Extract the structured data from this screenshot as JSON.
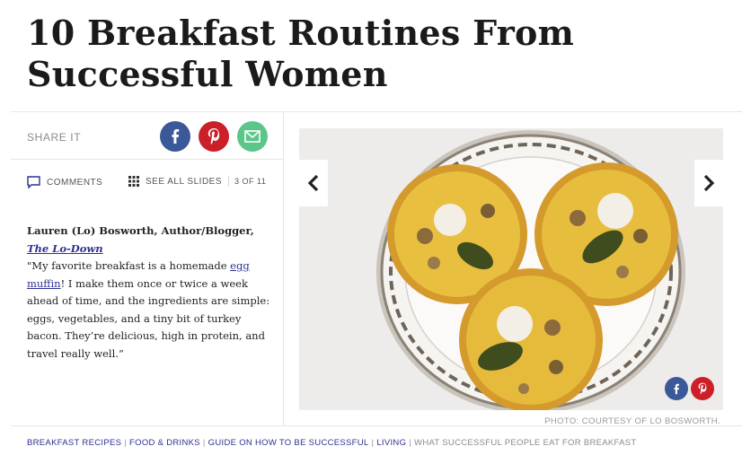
{
  "article": {
    "title": "10 Breakfast Routines From Successful Women"
  },
  "share": {
    "label": "SHARE IT",
    "icons": [
      "facebook-icon",
      "pinterest-icon",
      "email-icon"
    ],
    "colors": {
      "facebook": "#3b5998",
      "pinterest": "#cb2027",
      "email": "#5cc68a"
    }
  },
  "toolbar": {
    "comments_label": "COMMENTS",
    "slides_label": "SEE ALL SLIDES",
    "slide_count": "3 OF 11"
  },
  "slide": {
    "person": "Lauren (Lo) Bosworth, Author/Blogger,",
    "blog_link": "The Lo-Down",
    "quote_open": "\"My favorite breakfast is a homemade ",
    "quote_link": "egg muffin",
    "quote_rest": "! I make them once or twice a week ahead of time, and the ingredients are simple: eggs, vegetables, and a tiny bit of turkey bacon. They’re delicious, high in protein, and travel really well.”",
    "photo_credit": "PHOTO: COURTESY OF LO BOSWORTH."
  },
  "tags": {
    "links": [
      "BREAKFAST RECIPES",
      "FOOD & DRINKS",
      "GUIDE ON HOW TO BE SUCCESSFUL",
      "LIVING"
    ],
    "current": "WHAT SUCCESSFUL PEOPLE EAT FOR BREAKFAST",
    "separator": "|"
  },
  "colors": {
    "link": "#2e3192",
    "facebook": "#3b5998",
    "pinterest": "#cb2027"
  }
}
